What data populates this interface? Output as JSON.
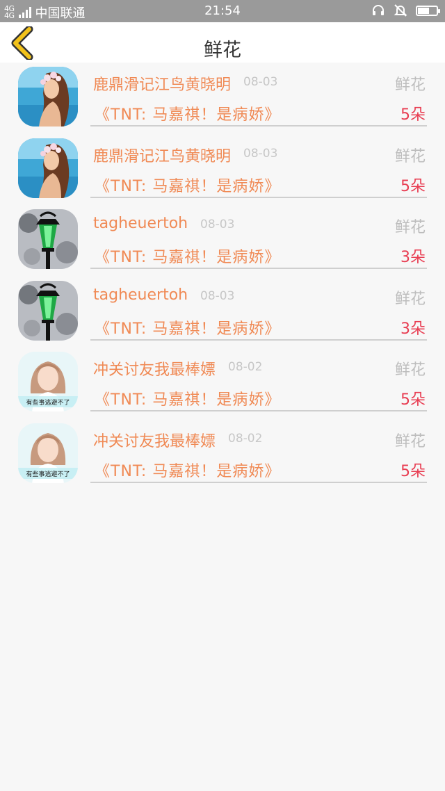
{
  "status_bar": {
    "network": "4G",
    "carrier": "中国联通",
    "time": "21:54",
    "battery_level": 0.6
  },
  "header": {
    "title": "鲜花"
  },
  "records": [
    {
      "sender": "鹿鼎滑记江鸟黄晓明",
      "date": "08-03",
      "type": "鲜花",
      "work": "《TNT: 马嘉祺！是病娇》",
      "amount": "5朵",
      "avatar": "beach-girl"
    },
    {
      "sender": "鹿鼎滑记江鸟黄晓明",
      "date": "08-03",
      "type": "鲜花",
      "work": "《TNT: 马嘉祺！是病娇》",
      "amount": "5朵",
      "avatar": "beach-girl"
    },
    {
      "sender": "tagheuertoh",
      "date": "08-03",
      "type": "鲜花",
      "work": "《TNT: 马嘉祺！是病娇》",
      "amount": "3朵",
      "avatar": "lamp"
    },
    {
      "sender": "tagheuertoh",
      "date": "08-03",
      "type": "鲜花",
      "work": "《TNT: 马嘉祺！是病娇》",
      "amount": "3朵",
      "avatar": "lamp"
    },
    {
      "sender": "冲关讨友我最棒嫖",
      "date": "08-02",
      "type": "鲜花",
      "work": "《TNT: 马嘉祺！是病娇》",
      "amount": "5朵",
      "avatar": "girl-caption",
      "avatar_caption": "有些事逃避不了"
    },
    {
      "sender": "冲关讨友我最棒嫖",
      "date": "08-02",
      "type": "鲜花",
      "work": "《TNT: 马嘉祺！是病娇》",
      "amount": "5朵",
      "avatar": "girl-caption",
      "avatar_caption": "有些事逃避不了"
    }
  ],
  "colors": {
    "accent": "#f08a55",
    "amount": "#e83d52",
    "back_icon": "#f2c21b",
    "muted": "#bdbdbd"
  }
}
